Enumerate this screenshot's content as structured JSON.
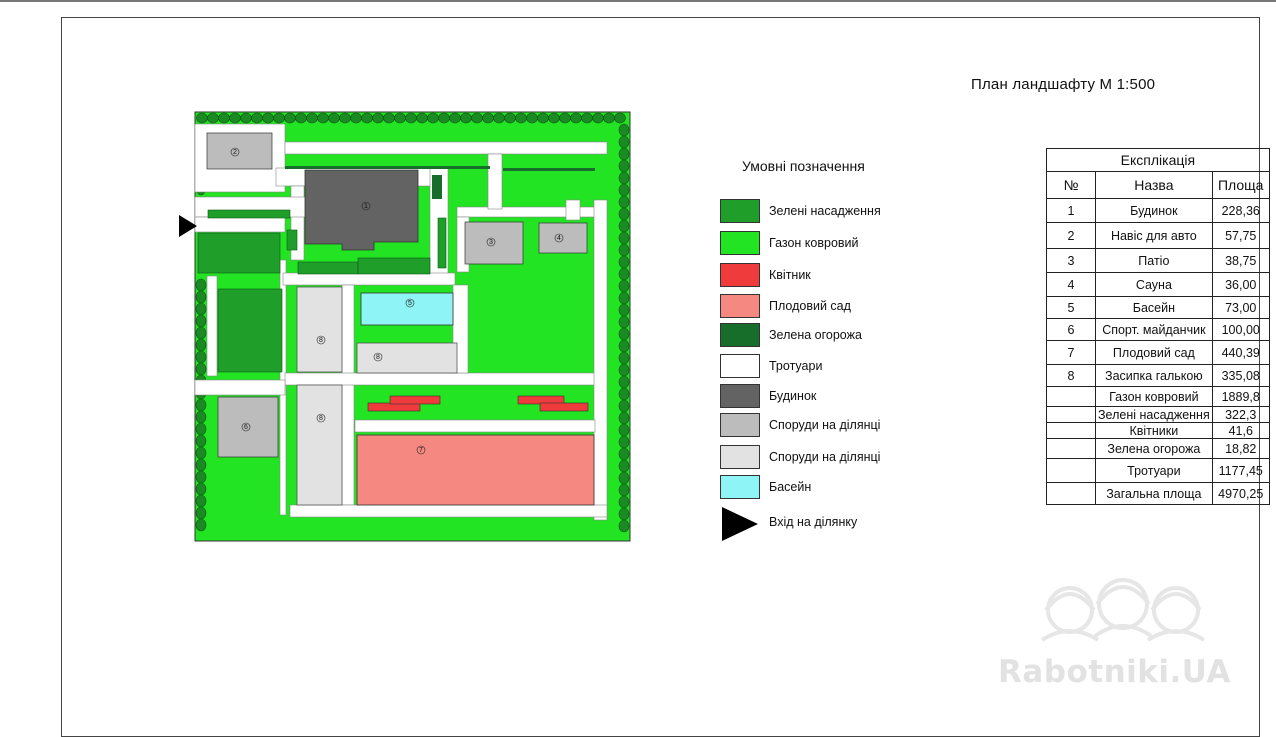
{
  "title": "План ландшафту М 1:500",
  "legend": {
    "title": "Умовні позначення",
    "items": [
      {
        "color": "#1f9e2a",
        "label": "Зелені насадження"
      },
      {
        "color": "#22e422",
        "label": "Газон ковровий"
      },
      {
        "color": "#ef3b3b",
        "label": "Квітник"
      },
      {
        "color": "#f58880",
        "label": "Плодовий сад"
      },
      {
        "color": "#166e2a",
        "label": "Зелена огорожа"
      },
      {
        "color": "#ffffff",
        "label": "Тротуари"
      },
      {
        "color": "#636363",
        "label": "Будинок"
      },
      {
        "color": "#bcbcbc",
        "label": "Споруди на ділянці"
      },
      {
        "color": "#e2e2e2",
        "label": "Споруди на ділянці"
      },
      {
        "color": "#8ff4f6",
        "label": "Басейн"
      },
      {
        "color": "#000000",
        "label": "Вхід на ділянку",
        "icon": "entrance-arrow-icon"
      }
    ]
  },
  "explication": {
    "title": "Експлікація",
    "headers": [
      "№",
      "Назва",
      "Площа"
    ],
    "rows": [
      [
        "1",
        "Будинок",
        "228,36"
      ],
      [
        "2",
        "Навіс для авто",
        "57,75"
      ],
      [
        "3",
        "Патіо",
        "38,75"
      ],
      [
        "4",
        "Сауна",
        "36,00"
      ],
      [
        "5",
        "Басейн",
        "73,00"
      ],
      [
        "6",
        "Спорт. майданчик",
        "100,00"
      ],
      [
        "7",
        "Плодовий сад",
        "440,39"
      ],
      [
        "8",
        "Засипка галькою",
        "335,08"
      ],
      [
        "",
        "Газон ковровий",
        "1889,8"
      ],
      [
        "",
        "Зелені насадження",
        "322,3"
      ],
      [
        "",
        "Квітники",
        "41,6"
      ],
      [
        "",
        "Зелена огорожа",
        "18,82"
      ],
      [
        "",
        "Тротуари",
        "1177,45"
      ],
      [
        "",
        "Загальна площа",
        "4970,25"
      ]
    ]
  },
  "plan": {
    "numbers": [
      "1",
      "2",
      "3",
      "4",
      "5",
      "6",
      "7",
      "8"
    ]
  },
  "watermark": "Rabotniki.UA"
}
